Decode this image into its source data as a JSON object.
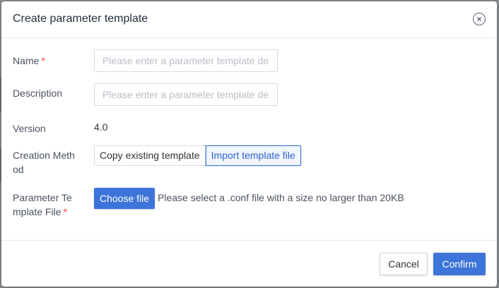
{
  "dialog": {
    "title": "Create parameter template",
    "close_icon": "close-circle-icon"
  },
  "form": {
    "name": {
      "label": "Name",
      "required_mark": "*",
      "placeholder": "Please enter a parameter template de",
      "value": ""
    },
    "description": {
      "label": "Description",
      "placeholder": "Please enter a parameter template de",
      "value": ""
    },
    "version": {
      "label": "Version",
      "value": "4.0"
    },
    "creation_method": {
      "label_line1": "Creation Meth",
      "label_line2": "od",
      "options": [
        "Copy existing template",
        "Import template file"
      ],
      "selected": "Import template file"
    },
    "template_file": {
      "label_line1": "Parameter Te",
      "label_line2": "mplate File",
      "required_mark": "*",
      "button_label": "Choose file",
      "hint": "Please select a .conf file with a size no larger than 20KB"
    }
  },
  "footer": {
    "cancel_label": "Cancel",
    "confirm_label": "Confirm"
  },
  "colors": {
    "primary": "#3d74d9",
    "required": "#e64a3c",
    "overlay": "#8a8d92"
  }
}
